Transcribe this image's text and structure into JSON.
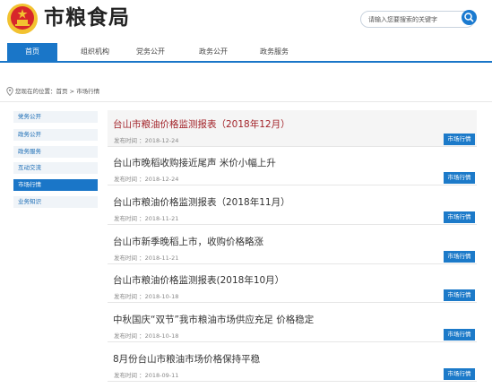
{
  "header": {
    "site_title": "市粮食局",
    "search_placeholder": "请输入您要搜索的关键字"
  },
  "nav": {
    "items": [
      "首页",
      "组织机构",
      "党务公开",
      "政务公开",
      "政务服务"
    ],
    "active": "首页"
  },
  "breadcrumb": "您现在的位置：首页 > 市场行情",
  "sidebar": {
    "items": [
      "党务公开",
      "政务公开",
      "政务服务",
      "互动交流",
      "市场行情",
      "业务知识"
    ],
    "active": "市场行情"
  },
  "articles": [
    {
      "title": "台山市粮油价格监测报表（2018年12月）",
      "date": "发布时间 ：2018-12-24",
      "tag": "市场行情",
      "highlight": true
    },
    {
      "title": "台山市晚稻收购接近尾声 米价小幅上升",
      "date": "发布时间 ：2018-12-24",
      "tag": "市场行情",
      "highlight": false
    },
    {
      "title": "台山市粮油价格监测报表（2018年11月）",
      "date": "发布时间 ：2018-11-21",
      "tag": "市场行情",
      "highlight": false
    },
    {
      "title": "台山市新季晚稻上市，收购价格略涨",
      "date": "发布时间 ：2018-11-21",
      "tag": "市场行情",
      "highlight": false
    },
    {
      "title": "台山市粮油价格监测报表(2018年10月）",
      "date": "发布时间 ：2018-10-18",
      "tag": "市场行情",
      "highlight": false
    },
    {
      "title": "中秋国庆“双节”我市粮油市场供应充足 价格稳定",
      "date": "发布时间 ：2018-10-18",
      "tag": "市场行情",
      "highlight": false
    },
    {
      "title": "8月份台山市粮油市场价格保持平稳",
      "date": "发布时间 ：2018-09-11",
      "tag": "市场行情",
      "highlight": false
    }
  ],
  "colors": {
    "accent": "#1a76c8",
    "highlight_title": "#a3242a",
    "emblem_red": "#d7262b",
    "emblem_gold": "#f2c230"
  },
  "icons": {
    "emblem": "national-emblem-icon",
    "search": "search-icon",
    "location": "location-pin-icon"
  }
}
